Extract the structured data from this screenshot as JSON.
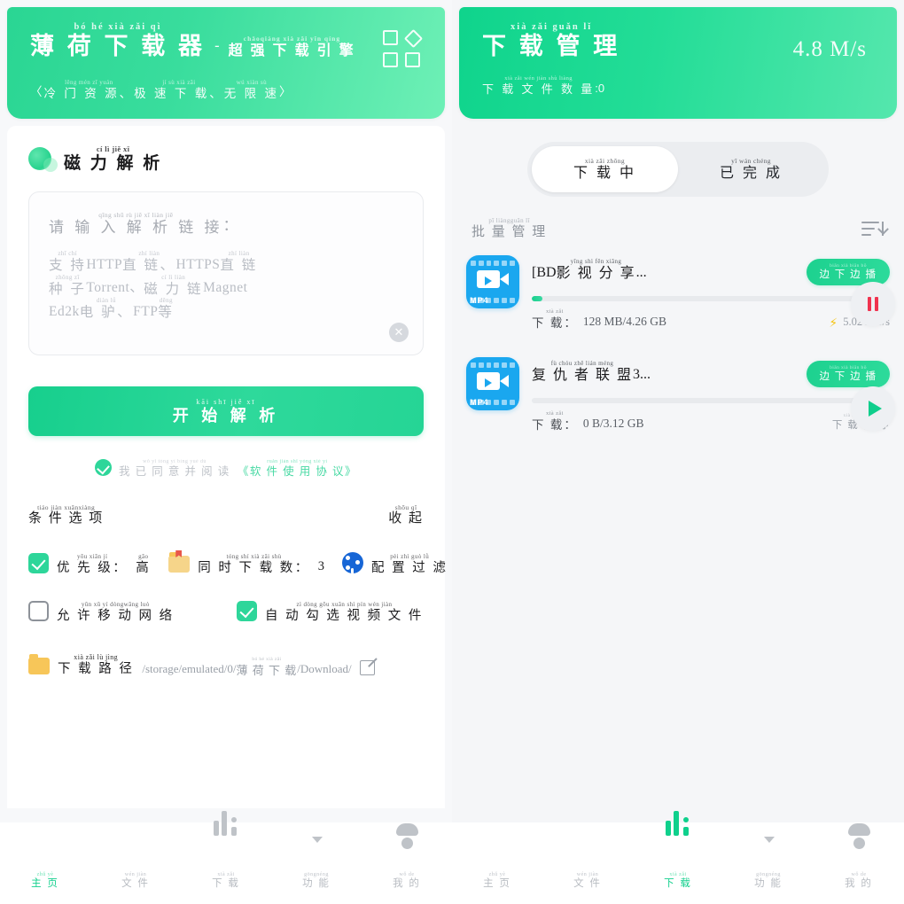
{
  "left": {
    "header": {
      "title_py": "bó  hé  xià  zǎi  qì",
      "title_hz": "薄 荷 下 载 器",
      "dash": "-",
      "sub_py": "chāoqiáng xià zǎi yǐn qíng",
      "sub_hz": "超 强 下 载 引 擎",
      "tagline_open": "〈",
      "tagline_py1": "lěng mén zī yuán",
      "tagline_hz1": "冷 门 资 源、",
      "tagline_py2": "jí  sù  xià zǎi",
      "tagline_hz2": "极 速 下 载、",
      "tagline_py3": "wú xiàn sù",
      "tagline_hz3": "无 限 速",
      "tagline_close": "〉",
      "grid_icon": "grid-icon"
    },
    "section": {
      "py": "cí   lì   jiě   xī",
      "hz": "磁 力 解 析"
    },
    "input": {
      "label_py": "qǐng shū rù  jiě  xī liàn jiē",
      "label_hz": "请 输 入 解 析 链 接",
      "label_colon": "：",
      "hint": [
        {
          "py1": "zhī chí",
          "hz1": "支 持",
          "plain1": "HTTP",
          "py2": "zhí liàn",
          "hz2": "直 链、",
          "plain2": "HTTPS",
          "py3": "zhí liàn",
          "hz3": "直 链"
        },
        {
          "py1": "zhǒng zǐ",
          "hz1": "种 子",
          "plain1": "Torrent、",
          "py2": "cí  lì  liàn",
          "hz2": "磁 力 链",
          "plain2": "Magnet",
          "py3": "",
          "hz3": ""
        },
        {
          "py1": "",
          "hz1": "",
          "plain1": "Ed2k",
          "py2": "diàn lǘ",
          "hz2": "电 驴、",
          "plain2": "FTP",
          "py3": "děng",
          "hz3": "等"
        }
      ],
      "clear_icon": "✕"
    },
    "parse_button": {
      "py": "kāi shī  jiě  xī",
      "hz": "开 始 解 析"
    },
    "agreement": {
      "checked": true,
      "py": "wǒ  yǐ  tóng yì bìng yuè dú",
      "hz": "我 已 同 意 并 阅 读",
      "link_py": "ruǎn jiàn shǐ yòng xié  yì",
      "link_hz": "《软 件 使 用 协 议》"
    },
    "options_header": {
      "title_py": "tiáo jiàn xuǎnxiàng",
      "title_hz": "条 件 选 项",
      "collapse_py": "shōu qǐ",
      "collapse_hz": "收 起"
    },
    "options_row1": [
      {
        "icon": "checkbox-checked",
        "checked": true,
        "py": "yōu xiān jí",
        "hz": "优 先 级：",
        "value_py": "gāo",
        "value_hz": "高"
      },
      {
        "icon": "folder-icon",
        "py": "tóng shí xià zǎi shù",
        "hz": "同 时 下 载 数：",
        "value": "3"
      },
      {
        "icon": "filter-icon",
        "py": "pèi zhì guò  lǜ",
        "hz": "配 置 过 滤"
      }
    ],
    "options_row2": [
      {
        "icon": "checkbox-unchecked",
        "checked": false,
        "py": "yǔn xǔ   yí dòngwǎng luò",
        "hz": "允 许 移 动 网 络"
      },
      {
        "icon": "checkbox-checked",
        "checked": true,
        "py": "zì dòng gōu xuǎn shì  pín wén jiàn",
        "hz": "自 动 勾 选 视 频 文 件"
      }
    ],
    "path": {
      "icon": "folder-icon",
      "py": "xià zǎi  lù jìng",
      "hz": "下 载 路 径",
      "value_pre": "/storage/emulated/0/",
      "value_py": "bó   hé  xià zǎi",
      "value_hz": "薄 荷 下 载",
      "value_post": "/Download/",
      "edit_icon": "edit-icon"
    }
  },
  "right": {
    "header": {
      "title_py": "xià  zǎi guǎn  lǐ",
      "title_hz": "下 载 管 理",
      "count_py": "xià  zǎi wén jiàn shù liàng",
      "count_hz": "下 载 文 件 数 量",
      "count_value": ":0",
      "speed": "4.8 M/s"
    },
    "tabs": [
      {
        "py": "xià  zǎi zhōng",
        "hz": "下 载 中",
        "active": true
      },
      {
        "py": "yǐ  wán chéng",
        "hz": "已 完 成",
        "active": false
      }
    ],
    "batch": {
      "py": "pī  liàngguǎn  lǐ",
      "hz": "批 量 管 理",
      "sort_icon": "sort-icon"
    },
    "items": [
      {
        "badge": "MP4",
        "name_pre": "[BD",
        "name_py": "yǐng shì  fēn xiǎng",
        "name_hz": "影 视 分 享",
        "name_post": "...",
        "button_py": "biān xià biān bō",
        "button_hz": "边 下 边 播",
        "progress_pct": 3,
        "label_py": "xià  zǎi",
        "label_hz": "下 载：",
        "size": "128 MB/4.26 GB",
        "speed": "5.02 MB/s",
        "bolt": "⚡",
        "status": null
      },
      {
        "badge": "MP4",
        "name_pre": "",
        "name_py": "fù  chóu zhě  lián méng",
        "name_hz": "复 仇 者 联 盟",
        "name_post": "3...",
        "button_py": "biān xià biān bō",
        "button_hz": "边 下 边 播",
        "progress_pct": 0,
        "label_py": "xià  zǎi",
        "label_hz": "下 载：",
        "size": "0 B/3.12 GB",
        "speed": null,
        "status_py": "xià  zǎi  zàn tíng",
        "status_hz": "下 载 暂 停"
      }
    ],
    "fabs": [
      {
        "icon": "pause-icon"
      },
      {
        "icon": "play-icon"
      }
    ]
  },
  "nav": [
    {
      "icon": "home-icon",
      "py": "zhǔ yè",
      "hz": "主 页",
      "active_left": true,
      "active_right": false
    },
    {
      "icon": "file-icon",
      "py": "wén jiàn",
      "hz": "文 件",
      "active_left": false,
      "active_right": false
    },
    {
      "icon": "download-icon",
      "py": "xià zǎi",
      "hz": "下 载",
      "active_left": false,
      "active_right": true
    },
    {
      "icon": "chat-icon",
      "py": "gōngnéng",
      "hz": "功 能",
      "active_left": false,
      "active_right": false
    },
    {
      "icon": "user-icon",
      "py": "wǒ de",
      "hz": "我 的",
      "active_left": false,
      "active_right": false
    }
  ],
  "colors": {
    "brand_green": "#2ed69a",
    "header_gradient_start": "#2ad693",
    "header_gradient_end": "#6ef0b6",
    "blue_icon": "#1aa7ef",
    "pause_red": "#f0334f",
    "folder_yellow": "#f7c659"
  }
}
